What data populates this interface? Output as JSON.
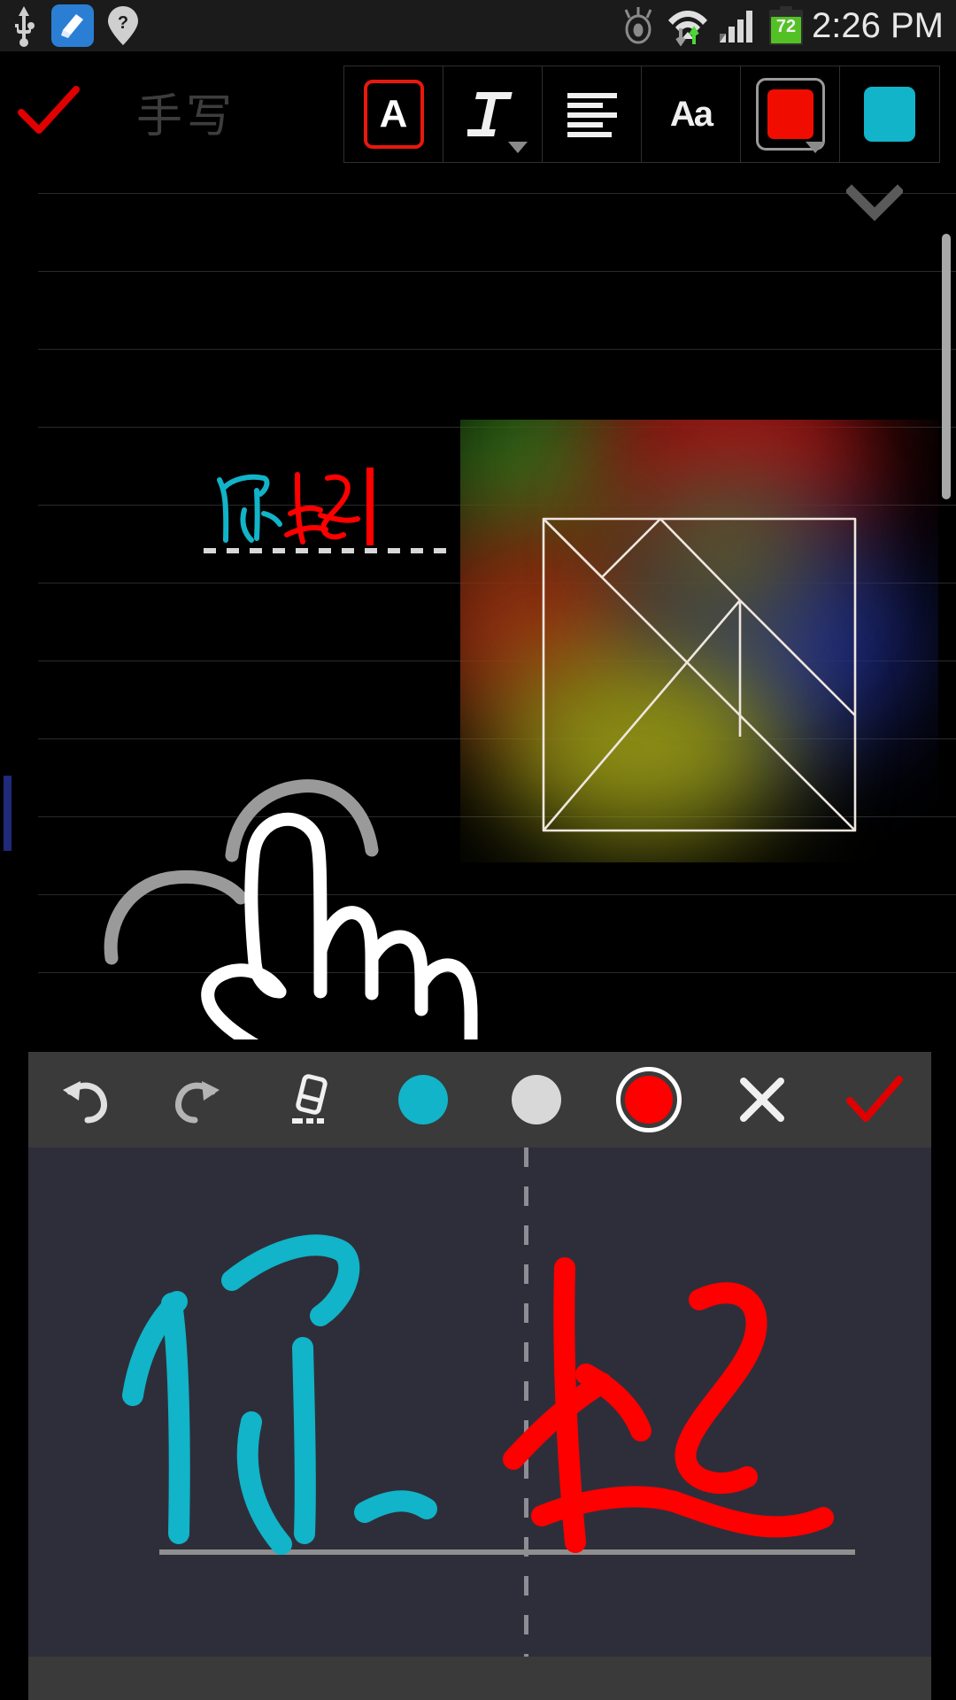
{
  "status_bar": {
    "icons_left": [
      "usb-icon",
      "cleaner-app-icon",
      "location-question-icon"
    ],
    "icons_right": [
      "smart-stay-eye-icon",
      "wifi-transfer-icon",
      "cellular-signal-icon"
    ],
    "battery_level": "72",
    "clock": "2:26 PM"
  },
  "top_toolbar": {
    "confirm_label": "✓",
    "title_placeholder": "手写",
    "buttons": [
      {
        "name": "text-style-A",
        "label": "A",
        "selected": true,
        "has_dropdown": false
      },
      {
        "name": "italic-T",
        "label": "T",
        "selected": false,
        "has_dropdown": true
      },
      {
        "name": "align-left",
        "label": "",
        "selected": false,
        "has_dropdown": false
      },
      {
        "name": "font-size-Aa",
        "label": "Aa",
        "selected": false,
        "has_dropdown": false
      },
      {
        "name": "color-red",
        "label": "",
        "selected": false,
        "has_dropdown": true,
        "color": "#f00d00"
      },
      {
        "name": "color-cyan",
        "label": "",
        "selected": false,
        "has_dropdown": false,
        "color": "#11b4c8"
      }
    ],
    "active_border_color": "#e8180c",
    "collapse_icon": "chevron-down-icon"
  },
  "note_canvas": {
    "background": "#000000",
    "rule_color": "#2a2a2a",
    "rule_count": 11,
    "rule_spacing": 88,
    "inline_handwriting": {
      "characters": [
        {
          "char": "你",
          "color": "#11b4c8"
        },
        {
          "char": "好",
          "color": "#ff0000"
        }
      ],
      "cursor_color": "#ff0000",
      "underline_style": "dashed",
      "underline_color": "#d8d8d8"
    },
    "drawings": [
      {
        "name": "tangram-square-sketch",
        "stroke": "#e8e0da"
      },
      {
        "name": "hand-pointing-sketch",
        "stroke_primary": "#ffffff",
        "stroke_secondary": "#9a9a9a"
      }
    ],
    "scrollbar_color": "#a8a8a8",
    "left_marker_color": "#1f2a7a"
  },
  "handwriting_panel": {
    "toolbar_background": "#3a3a3a",
    "surface_background": "#2e2e3a",
    "tools": [
      {
        "name": "undo-button",
        "icon": "undo-icon",
        "label": "↶"
      },
      {
        "name": "redo-button",
        "icon": "redo-icon",
        "label": "↷"
      },
      {
        "name": "eraser-button",
        "icon": "eraser-icon",
        "label": ""
      },
      {
        "name": "pen-color-cyan",
        "icon": "circle-icon",
        "color": "#11b4c8",
        "selected": false
      },
      {
        "name": "pen-color-white",
        "icon": "circle-icon",
        "color": "#d8d8d8",
        "selected": false
      },
      {
        "name": "pen-color-red",
        "icon": "circle-icon",
        "color": "#ff0000",
        "selected": true
      },
      {
        "name": "cancel-button",
        "icon": "close-icon",
        "label": "✕"
      },
      {
        "name": "confirm-button",
        "icon": "check-icon",
        "label": "✓"
      }
    ],
    "strokes": [
      {
        "char": "你",
        "color": "#11b4c8",
        "cell": "left"
      },
      {
        "char": "好",
        "color": "#ff0000",
        "cell": "right"
      }
    ],
    "divider_color": "#8d8d95",
    "baseline_color": "#8f8f8f"
  }
}
